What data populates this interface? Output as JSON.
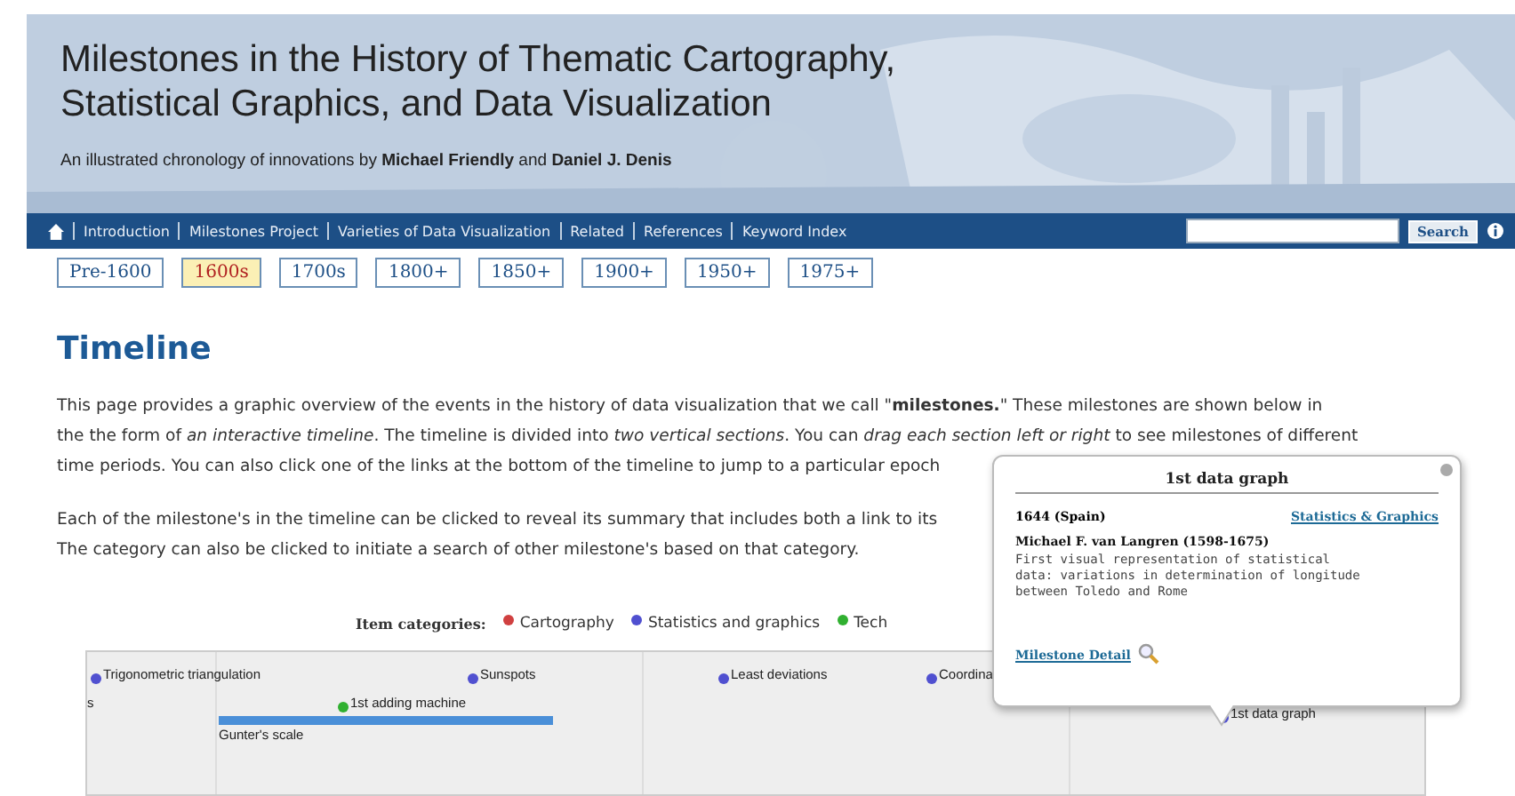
{
  "header": {
    "title_lines": [
      "Milestones in the History of Thematic Cartography,",
      "Statistical Graphics, and Data Visualization"
    ],
    "subtitle": "An illustrated chronology of innovations by **Michael Friendly** and **Daniel J. Denis**"
  },
  "nav": {
    "items": [
      "Introduction",
      "Milestones Project",
      "Varieties of Data Visualization",
      "Related",
      "References",
      "Keyword Index"
    ],
    "search_button": "Search"
  },
  "epochs": [
    {
      "label": "Pre-1600",
      "selected": false
    },
    {
      "label": "1600s",
      "selected": true
    },
    {
      "label": "1700s",
      "selected": false
    },
    {
      "label": "1800+",
      "selected": false
    },
    {
      "label": "1850+",
      "selected": false
    },
    {
      "label": "1900+",
      "selected": false
    },
    {
      "label": "1950+",
      "selected": false
    },
    {
      "label": "1975+",
      "selected": false
    }
  ],
  "heading": "Timeline",
  "paragraphs": [
    [
      "This page provides a graphic overview of the events in the history of data visualization that we call \"**milestones.**\" These milestones are shown below in",
      "the the form of *an interactive timeline*. The timeline is divided into *two vertical sections*. You can *drag each section left or right* to see milestones of different",
      "time periods. You can also click one of the links at the bottom of the timeline to jump to a particular epoch"
    ],
    [
      "Each of the milestone's in the timeline can be clicked to reveal its summary that includes both a link to its",
      "The category can also be clicked to initiate a search of other milestone's based on that category."
    ]
  ],
  "legend": {
    "label": "Item categories:",
    "items": [
      {
        "name": "Cartography",
        "color": "#d04040"
      },
      {
        "name": "Statistics and graphics",
        "color": "#5050d0"
      },
      {
        "name": "Tech",
        "color": "#30b030"
      }
    ]
  },
  "timeline": {
    "events": [
      {
        "kind": "point",
        "label": "Trigonometric triangulation",
        "color": "#5050d0"
      },
      {
        "kind": "point",
        "label": "Sunspots",
        "color": "#5050d0"
      },
      {
        "kind": "point",
        "label": "Least deviations",
        "color": "#5050d0"
      },
      {
        "kind": "point",
        "label": "Coordina",
        "color": "#5050d0"
      },
      {
        "kind": "text",
        "label": "s"
      },
      {
        "kind": "point",
        "label": "1st adding machine",
        "color": "#30b030"
      },
      {
        "kind": "point",
        "label": "1st data graph",
        "color": "#5050d0"
      },
      {
        "kind": "span",
        "label": "Gunter's scale"
      }
    ]
  },
  "popup": {
    "title": "1st data graph",
    "date": "1644 (Spain)",
    "category": "Statistics & Graphics",
    "author": "Michael F. van Langren (1598-1675)",
    "description": "First visual representation of statistical data: variations in determination of longitude between Toledo and Rome",
    "detail_link": "Milestone Detail"
  }
}
